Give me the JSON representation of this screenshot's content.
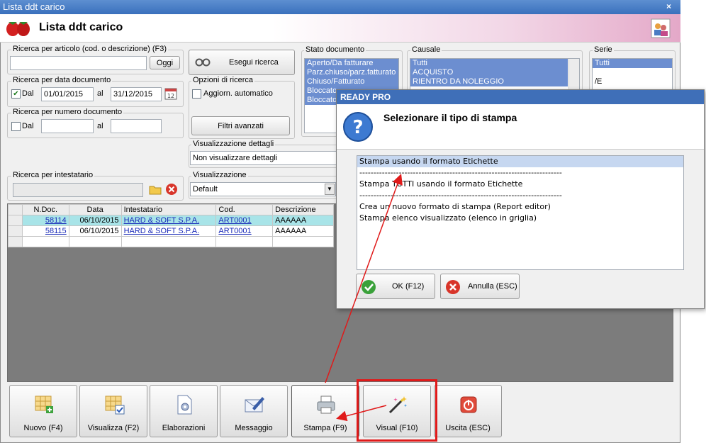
{
  "window": {
    "title": "Lista ddt carico",
    "close": "×"
  },
  "header": {
    "title": "Lista ddt carico"
  },
  "search_article": {
    "legend": "Ricerca per articolo (cod. o descrizione) (F3)",
    "value": "",
    "button": "Oggi"
  },
  "search_date": {
    "legend": "Ricerca per data documento",
    "from_label": "Dal",
    "from_checked": true,
    "from_value": "01/01/2015",
    "to_label": "al",
    "to_value": "31/12/2015"
  },
  "search_number": {
    "legend": "Ricerca per numero documento",
    "from_label": "Dal",
    "from_checked": false,
    "from_value": "",
    "to_label": "al",
    "to_value": ""
  },
  "search_button": "Esegui ricerca",
  "search_options": {
    "legend": "Opzioni di ricerca",
    "auto_update": "Aggiorn. automatico",
    "advanced": "Filtri avanzati"
  },
  "stato_documento": {
    "legend": "Stato documento",
    "items": [
      "Aperto/Da fatturare",
      "Parz.chiuso/parz.fatturato",
      "Chiuso/Fatturato",
      "Bloccato",
      "Bloccato"
    ]
  },
  "causale": {
    "legend": "Causale",
    "items": [
      "Tutti",
      "ACQUISTO",
      "RIENTRO DA NOLEGGIO"
    ]
  },
  "serie": {
    "legend": "Serie",
    "items": [
      "Tutti",
      "",
      "/E"
    ]
  },
  "details": {
    "legend": "Visualizzazione dettagli",
    "value": "Non visualizzare dettagli"
  },
  "intestatario": {
    "legend": "Ricerca per intestatario",
    "value": ""
  },
  "visualizzazione": {
    "legend": "Visualizzazione",
    "value": "Default"
  },
  "grid": {
    "columns": [
      "N.Doc.",
      "Data",
      "Intestatario",
      "Cod.",
      "Descrizione"
    ],
    "rows": [
      {
        "ndoc": "58114",
        "data": "06/10/2015",
        "intestatario": "HARD & SOFT S.P.A.",
        "cod": "ART0001",
        "descrizione": "AAAAAA"
      },
      {
        "ndoc": "58115",
        "data": "06/10/2015",
        "intestatario": "HARD & SOFT S.P.A.",
        "cod": "ART0001",
        "descrizione": "AAAAAA"
      }
    ]
  },
  "toolbar": {
    "nuovo": "Nuovo (F4)",
    "visualizza": "Visualizza (F2)",
    "elaborazioni": "Elaborazioni",
    "messaggio": "Messaggio",
    "stampa": "Stampa (F9)",
    "visual": "Visual (F10)",
    "uscita": "Uscita (ESC)"
  },
  "dialog": {
    "title": "READY PRO",
    "heading": "Selezionare il tipo di stampa",
    "options": [
      "Stampa usando il formato Etichette",
      "------------------------------------------------------------------------",
      "Stampa TUTTI usando il formato Etichette",
      "------------------------------------------------------------------------",
      "Crea un nuovo formato di stampa (Report editor)",
      "Stampa elenco visualizzato (elenco in griglia)"
    ],
    "ok": "OK (F12)",
    "cancel": "Annulla (ESC)"
  },
  "colors": {
    "accent": "#3f6fb8",
    "selection": "#6c8ed0",
    "highlight_row": "#a8e4e8",
    "arrow": "#e01a1a",
    "box": "#e01a1a"
  }
}
